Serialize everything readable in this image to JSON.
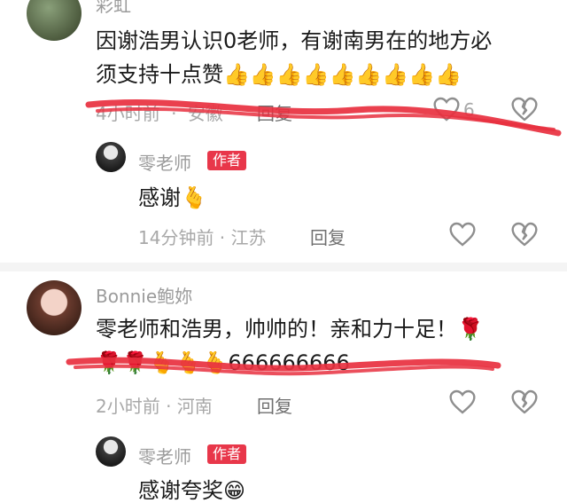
{
  "comments": [
    {
      "username": "彩虹",
      "text_line1": "因谢浩男认识0老师，有谢南男在的地方必",
      "text_line2": "须支持十点赞👍👍👍👍👍👍👍👍👍",
      "time": "4小时前",
      "location": "安徽",
      "reply": "回复",
      "like_count": "6"
    },
    {
      "username": "零老师",
      "badge": "作者",
      "text": "感谢🫰",
      "time": "14分钟前 · 江苏",
      "reply": "回复"
    },
    {
      "username": "Bonnie鲍妳",
      "text_line1": "零老师和浩男，帅帅的！亲和力十足！🌹",
      "text_line2": "🌹🌹🫰🫰🫰666666666",
      "time": "2小时前 · 河南",
      "reply": "回复"
    },
    {
      "username": "零老师",
      "badge": "作者",
      "text": "感谢夸奖😁"
    }
  ],
  "colors": {
    "badge": "#e8374a",
    "scribble": "#e8303f",
    "muted": "#a8a8a8",
    "icon": "#8e8e8e"
  }
}
